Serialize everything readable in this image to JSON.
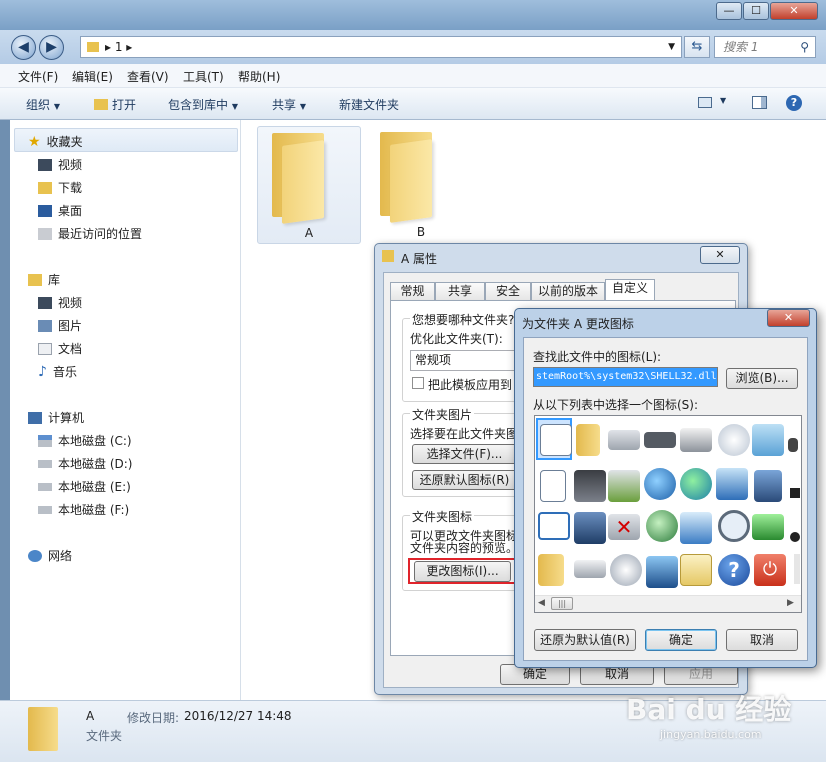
{
  "window": {
    "close": "✕",
    "minimize": "—",
    "maximize": "☐"
  },
  "address": {
    "path": "1",
    "search_placeholder": "搜索 1"
  },
  "menu": [
    "文件(F)",
    "编辑(E)",
    "查看(V)",
    "工具(T)",
    "帮助(H)"
  ],
  "toolbar": {
    "organize": "组织",
    "open": "打开",
    "include": "包含到库中",
    "share": "共享",
    "new_folder": "新建文件夹"
  },
  "nav": {
    "favorites": "收藏夹",
    "videos": "视频",
    "downloads": "下载",
    "desktop": "桌面",
    "recent": "最近访问的位置",
    "libraries": "库",
    "lib_videos": "视频",
    "pictures": "图片",
    "documents": "文档",
    "music": "音乐",
    "computer": "计算机",
    "disk_c": "本地磁盘 (C:)",
    "disk_d": "本地磁盘 (D:)",
    "disk_e": "本地磁盘 (E:)",
    "disk_f": "本地磁盘 (F:)",
    "network": "网络"
  },
  "files": [
    {
      "name": "A"
    },
    {
      "name": "B"
    }
  ],
  "status": {
    "name": "A",
    "modified_label": "修改日期:",
    "modified_value": "2016/12/27 14:48",
    "type": "文件夹"
  },
  "props": {
    "title": "A 属性",
    "tabs": [
      "常规",
      "共享",
      "安全",
      "以前的版本",
      "自定义"
    ],
    "q_folder_type": "您想要哪种文件夹?",
    "optimize_label": "优化此文件夹(T):",
    "optimize_value": "常规项",
    "apply_template": "把此模板应用到",
    "folder_pics": "文件夹图片",
    "choose_file_desc": "选择要在此文件夹图",
    "choose_file_btn": "选择文件(F)...",
    "restore_default_btn": "还原默认图标(R)",
    "folder_icons": "文件夹图标",
    "icon_desc_1": "可以更改文件夹图标",
    "icon_desc_2": "文件夹内容的预览。",
    "change_icon_btn": "更改图标(I)...",
    "ok": "确定",
    "cancel": "取消",
    "apply": "应用"
  },
  "change_icon": {
    "title": "为文件夹 A 更改图标",
    "find_label": "查找此文件中的图标(L):",
    "path_value": "stemRoot%\\system32\\SHELL32.dll",
    "browse_btn": "浏览(B)...",
    "select_label": "从以下列表中选择一个图标(S):",
    "restore_btn": "还原为默认值(R)",
    "ok_btn": "确定",
    "cancel_btn": "取消"
  },
  "watermark": {
    "brand": "Bai du 经验",
    "sub": "jingyan.baidu.com"
  },
  "colors": {
    "selection": "#3399ff",
    "folder": "#f2d37a",
    "highlight_box": "#e0242b"
  }
}
